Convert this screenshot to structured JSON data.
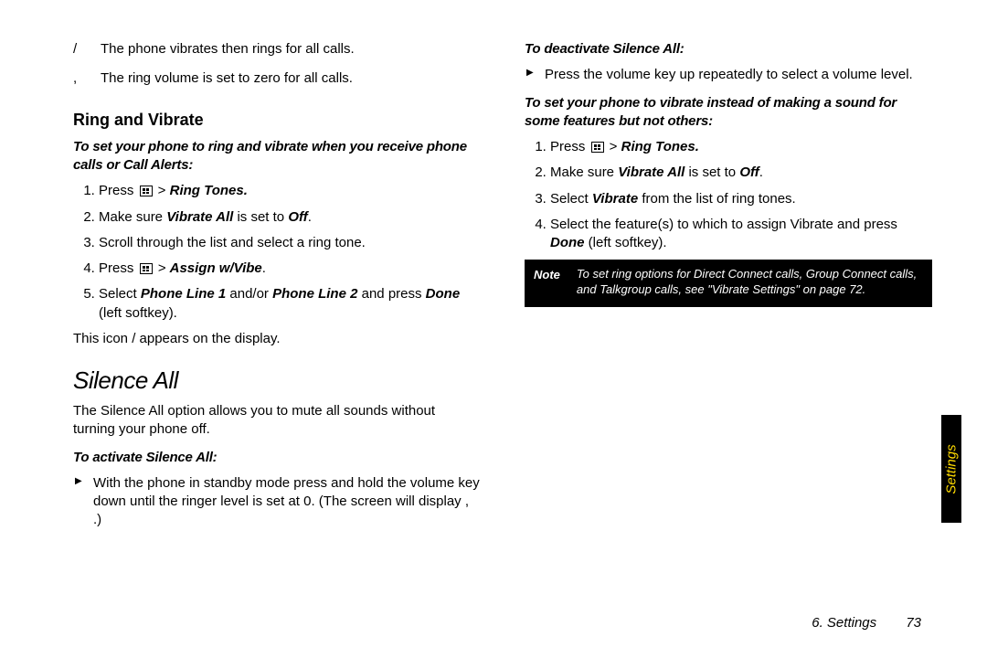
{
  "col1": {
    "rows": [
      {
        "sym": "/",
        "txt": "The phone vibrates then rings for all calls."
      },
      {
        "sym": ",",
        "txt": "The ring volume is set to zero for all calls."
      }
    ],
    "sub_heading": "Ring and Vibrate",
    "lead1": "To set your phone to ring and vibrate when you receive phone calls or Call Alerts:",
    "steps1": {
      "s1a": "Press ",
      "s1b": " > ",
      "s1c": "Ring Tones.",
      "s2a": "Make sure ",
      "s2b": "Vibrate All",
      "s2c": " is set to ",
      "s2d": "Off",
      "s2e": ".",
      "s3": "Scroll through the list and select a ring tone.",
      "s4a": "Press ",
      "s4b": " > ",
      "s4c": "Assign w/Vibe",
      "s4d": ".",
      "s5a": "Select ",
      "s5b": "Phone Line 1",
      "s5c": " and/or ",
      "s5d": "Phone Line 2",
      "s5e": " and press ",
      "s5f": "Done",
      "s5g": " (left softkey)."
    },
    "after_steps": "This icon /   appears on the display.",
    "section_title": "Silence All",
    "section_body": "The Silence All option allows you to mute all sounds without turning your phone off."
  },
  "col2": {
    "lead_act": "To activate Silence All:",
    "bullet_act": "With the phone in standby mode press and hold the volume key down until the ringer level is set at 0. (The screen will display  ,  .)",
    "lead_deact": "To deactivate Silence All:",
    "bullet_deact": "Press the volume key up repeatedly to select a volume level.",
    "lead_vib": "To set your phone to vibrate instead of making a sound for some features but not others:",
    "steps2": {
      "s1a": "Press ",
      "s1b": " > ",
      "s1c": "Ring Tones.",
      "s2a": "Make sure ",
      "s2b": "Vibrate All",
      "s2c": " is set to ",
      "s2d": "Off",
      "s2e": ".",
      "s3a": "Select ",
      "s3b": "Vibrate",
      "s3c": " from the list of ring tones.",
      "s4a": "Select the feature(s) to which to assign Vibrate and press ",
      "s4b": "Done",
      "s4c": " (left softkey)."
    },
    "note_label": "Note",
    "note_body": "To set ring options for Direct Connect calls, Group Connect calls, and Talkgroup calls, see \"Vibrate Settings\" on page 72."
  },
  "side_tab": "Settings",
  "footer_chapter": "6. Settings",
  "footer_page": "73"
}
